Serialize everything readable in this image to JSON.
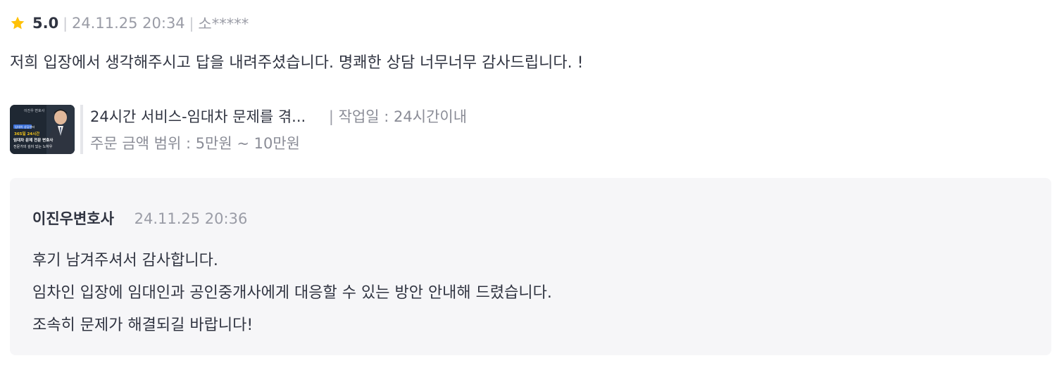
{
  "review": {
    "rating": "5.0",
    "separator": "|",
    "date": "24.11.25 20:34",
    "author": "소*****",
    "star_color": "#ffc107",
    "text": "저희 입장에서 생각해주시고 답을 내려주셨습니다. 명쾌한 상담 너무너무 감사드립니다. !"
  },
  "service": {
    "title": "24시간 서비스-임대차 문제를 겪...",
    "work_sep": "|",
    "work_label": "작업일 : 24시간이내",
    "price_label": "주문 금액 범위 : 5만원 ~ 10만원",
    "thumbnail": {
      "tag": "이진우 변호사",
      "badge": "임대차 상담센터",
      "highlight": "365일 24시간",
      "line1": "임대차 문제 전문 변호사",
      "line2": "전문가의 깊이 있는 노하우"
    }
  },
  "reply": {
    "author": "이진우변호사",
    "date": "24.11.25 20:36",
    "lines": [
      "후기 남겨주셔서 감사합니다.",
      "임차인 입장에 임대인과 공인중개사에게 대응할 수 있는 방안 안내해 드렸습니다.",
      "조속히 문제가 해결되길 바랍니다!"
    ]
  }
}
